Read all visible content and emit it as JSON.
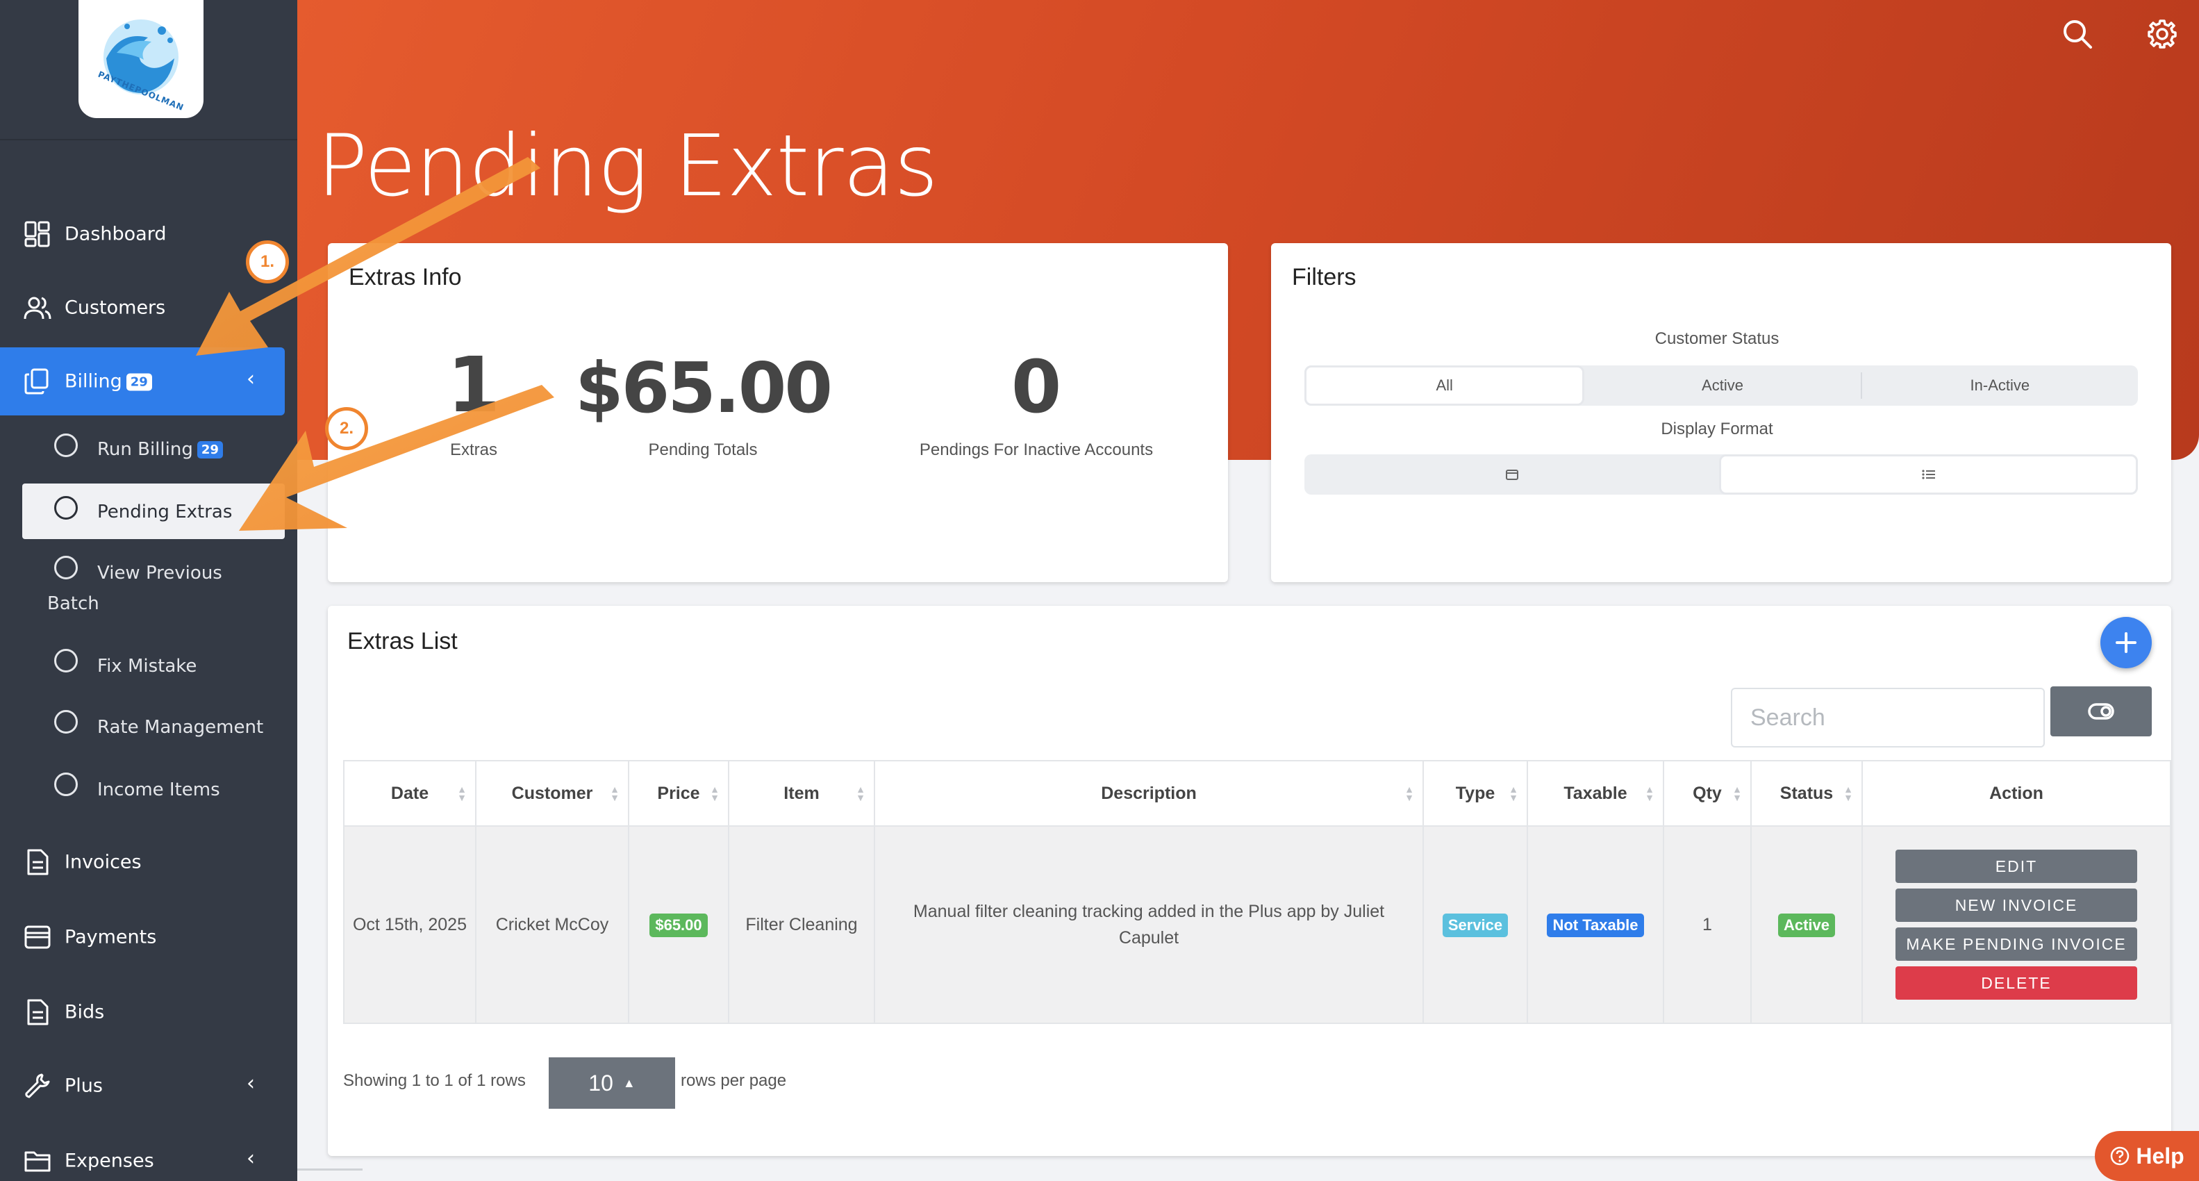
{
  "sidebar": {
    "brand_text": "PAYTHEPOOLMAN",
    "items": [
      {
        "label": "Dashboard",
        "icon": "dashboard-icon"
      },
      {
        "label": "Customers",
        "icon": "users-icon"
      },
      {
        "label": "Billing",
        "icon": "billing-icon",
        "badge": "29",
        "active": true
      },
      {
        "label": "Invoices",
        "icon": "document-icon"
      },
      {
        "label": "Payments",
        "icon": "card-icon"
      },
      {
        "label": "Bids",
        "icon": "document-icon"
      },
      {
        "label": "Plus",
        "icon": "wrench-icon"
      },
      {
        "label": "Expenses",
        "icon": "folder-icon"
      }
    ],
    "sub_items": [
      {
        "label": "Run Billing",
        "badge": "29"
      },
      {
        "label": "Pending Extras",
        "selected": true
      },
      {
        "label_line1": "View Previous",
        "label_line2": "Batch"
      },
      {
        "label": "Fix Mistake"
      },
      {
        "label": "Rate Management"
      },
      {
        "label": "Income Items"
      }
    ]
  },
  "header": {
    "title": "Pending Extras"
  },
  "extras_info": {
    "title": "Extras Info",
    "stats": [
      {
        "value": "1",
        "label": "Extras"
      },
      {
        "value": "$65.00",
        "label": "Pending Totals"
      },
      {
        "value": "0",
        "label": "Pendings For Inactive Accounts"
      }
    ]
  },
  "filters": {
    "title": "Filters",
    "customer_status_label": "Customer Status",
    "customer_status_options": [
      "All",
      "Active",
      "In-Active"
    ],
    "customer_status_selected": "All",
    "display_format_label": "Display Format"
  },
  "extras_list": {
    "title": "Extras List",
    "search_placeholder": "Search",
    "columns": [
      "Date",
      "Customer",
      "Price",
      "Item",
      "Description",
      "Type",
      "Taxable",
      "Qty",
      "Status",
      "Action"
    ],
    "rows": [
      {
        "date": "Oct 15th, 2025",
        "customer": "Cricket McCoy",
        "price": "$65.00",
        "item": "Filter Cleaning",
        "description": "Manual filter cleaning tracking added in the Plus app by Juliet Capulet",
        "type": "Service",
        "taxable": "Not Taxable",
        "qty": "1",
        "status": "Active",
        "actions": [
          "EDIT",
          "NEW INVOICE",
          "MAKE PENDING INVOICE",
          "DELETE"
        ]
      }
    ],
    "pagination": {
      "showing_text": "Showing 1 to 1 of 1 rows",
      "page_size": "10",
      "rows_per_page_text": "rows per page"
    }
  },
  "help_label": "Help",
  "annotations": [
    "1.",
    "2."
  ],
  "colors": {
    "sidebar_bg": "#343a45",
    "accent_blue": "#2f7dea",
    "header_orange": "#e55b2e",
    "annotation_orange": "#f0852f",
    "badge_green": "#5cb85c",
    "badge_cyan": "#5bc0de",
    "badge_blue": "#2f7dea",
    "delete_red": "#dd3c4a"
  }
}
